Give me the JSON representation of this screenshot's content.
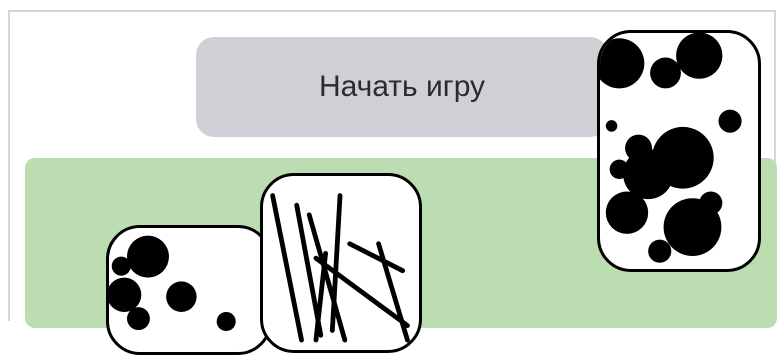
{
  "app": {
    "start_button_label": "Начать игру"
  },
  "colors": {
    "button_bg": "#cfcfd6",
    "table_bg": "#bcdcb1",
    "card_border": "#000000"
  },
  "cards": [
    {
      "pattern": "dots",
      "state": "face-up"
    },
    {
      "pattern": "lines",
      "state": "face-up"
    },
    {
      "pattern": "dots",
      "state": "face-up"
    }
  ]
}
